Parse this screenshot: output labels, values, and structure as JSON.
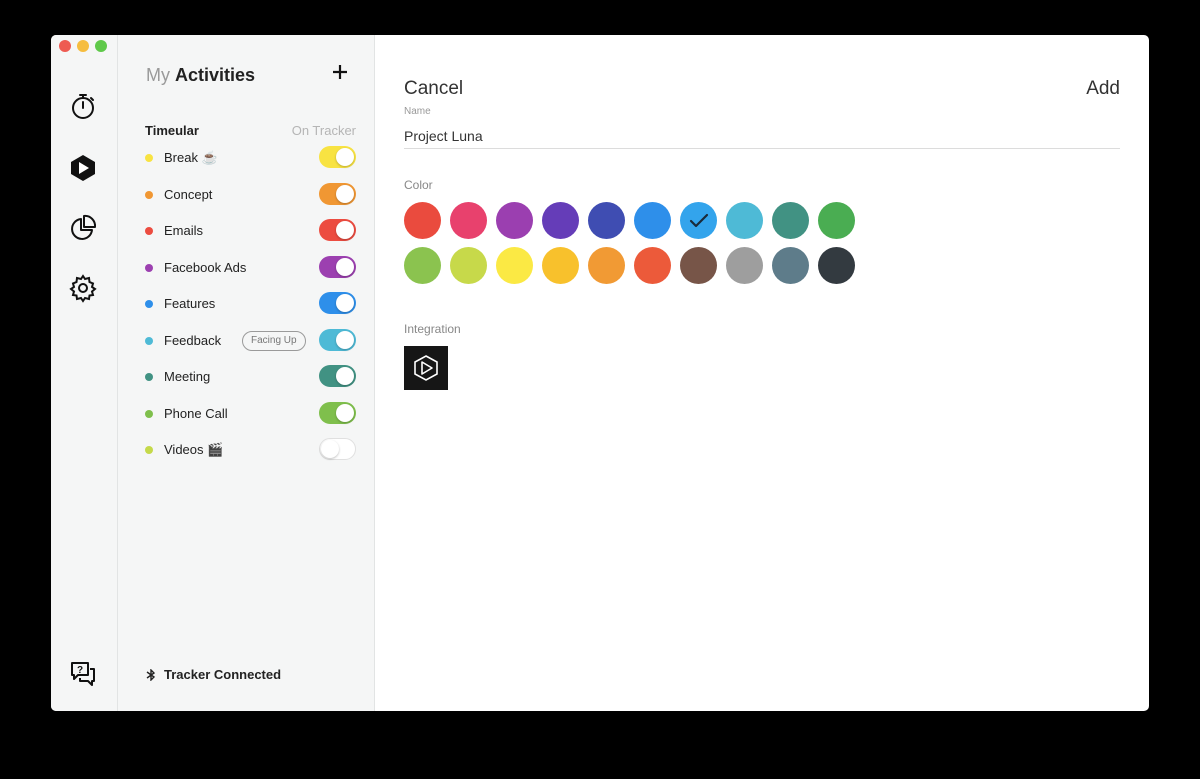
{
  "header": {
    "title_light": "My",
    "title_bold": "Activities"
  },
  "group": {
    "name": "Timeular",
    "right_label": "On Tracker"
  },
  "activities": [
    {
      "label": "Break ☕",
      "color": "#f8e342",
      "on": true
    },
    {
      "label": "Concept",
      "color": "#f09733",
      "on": true
    },
    {
      "label": "Emails",
      "color": "#ec4c40",
      "on": true
    },
    {
      "label": "Facebook Ads",
      "color": "#9c40b0",
      "on": true
    },
    {
      "label": "Features",
      "color": "#2e8fea",
      "on": true
    },
    {
      "label": "Feedback",
      "color": "#4ebad6",
      "on": true,
      "badge": "Facing Up"
    },
    {
      "label": "Meeting",
      "color": "#419283",
      "on": true
    },
    {
      "label": "Phone Call",
      "color": "#7fbf4c",
      "on": true
    },
    {
      "label": "Videos 🎬",
      "color": "#c5d94a",
      "on": false
    }
  ],
  "status": {
    "text": "Tracker Connected"
  },
  "form": {
    "cancel_label": "Cancel",
    "add_label": "Add",
    "name_label": "Name",
    "name_value": "Project Luna",
    "color_label": "Color",
    "integration_label": "Integration"
  },
  "colors": [
    [
      "#ea4b3e",
      "#e8416d",
      "#9b3fb0",
      "#653db8",
      "#3f4db2",
      "#2e8fea",
      "#33a4ec",
      "#4ebad6",
      "#419283",
      "#4aad52"
    ],
    [
      "#8bc34f",
      "#c7d94a",
      "#fbe944",
      "#f8c12c",
      "#f19a34",
      "#ec5a3a",
      "#775548",
      "#9e9e9e",
      "#5e7c8a",
      "#333a40"
    ]
  ],
  "selected_color": "#33a4ec",
  "traffic_lights": [
    "#ee5b52",
    "#f6bd3f",
    "#5fc94a"
  ]
}
